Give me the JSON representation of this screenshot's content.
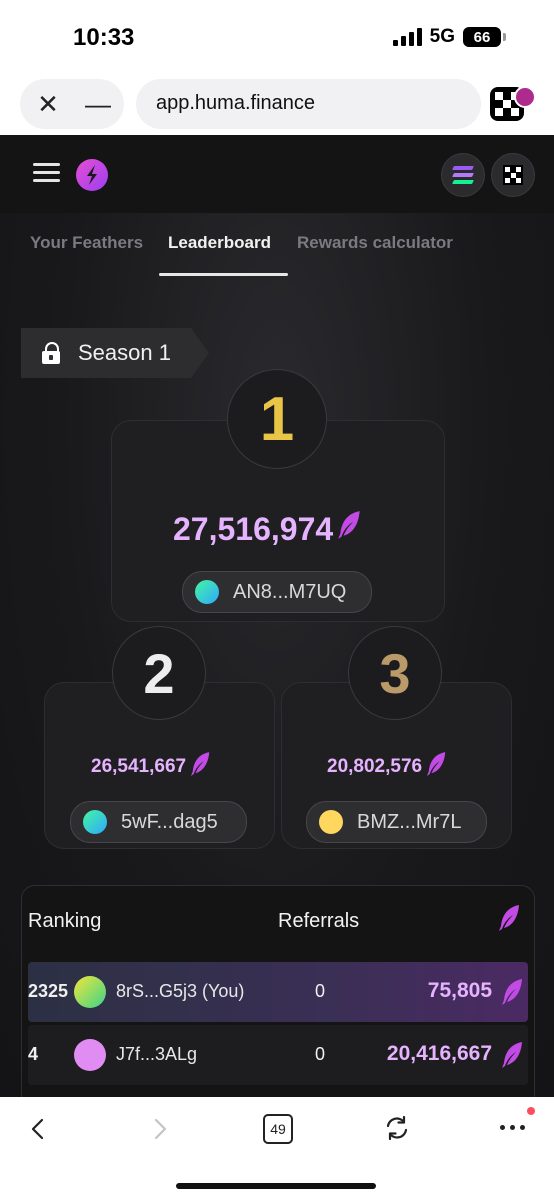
{
  "status_bar": {
    "time": "10:33",
    "network": "5G",
    "battery": "66"
  },
  "browser": {
    "url": "app.huma.finance",
    "close_icon": "close-icon",
    "minimize_icon": "minus-icon"
  },
  "app": {
    "tabs": [
      {
        "label": "Your Feathers"
      },
      {
        "label": "Leaderboard",
        "active": true
      },
      {
        "label": "Rewards calculator"
      }
    ],
    "season": {
      "label": "Season 1"
    },
    "podium": {
      "first": {
        "rank": "1",
        "score": "27,516,974",
        "address": "AN8...M7UQ",
        "avatar_color": "#3ee0a6"
      },
      "second": {
        "rank": "2",
        "score": "26,541,667",
        "address": "5wF...dag5",
        "avatar_color": "#3ee0a6"
      },
      "third": {
        "rank": "3",
        "score": "20,802,576",
        "address": "BMZ...Mr7L",
        "avatar_color": "#ffd75e"
      }
    },
    "table": {
      "headers": {
        "ranking": "Ranking",
        "referrals": "Referrals"
      },
      "rows": [
        {
          "rank": "2325",
          "address": "8rS...G5j3  (You)",
          "referrals": "0",
          "value": "75,805",
          "avatar_color": "#c7ea3c"
        },
        {
          "rank": "4",
          "address": "J7f...3ALg",
          "referrals": "0",
          "value": "20,416,667",
          "avatar_color": "#e08cf2"
        }
      ]
    }
  },
  "toolbar": {
    "tabs_count": "49"
  },
  "colors": {
    "accent": "#e6b3ff",
    "gold": "#e8c547",
    "bronze": "#b99a68",
    "brand": "#c24ae5"
  }
}
